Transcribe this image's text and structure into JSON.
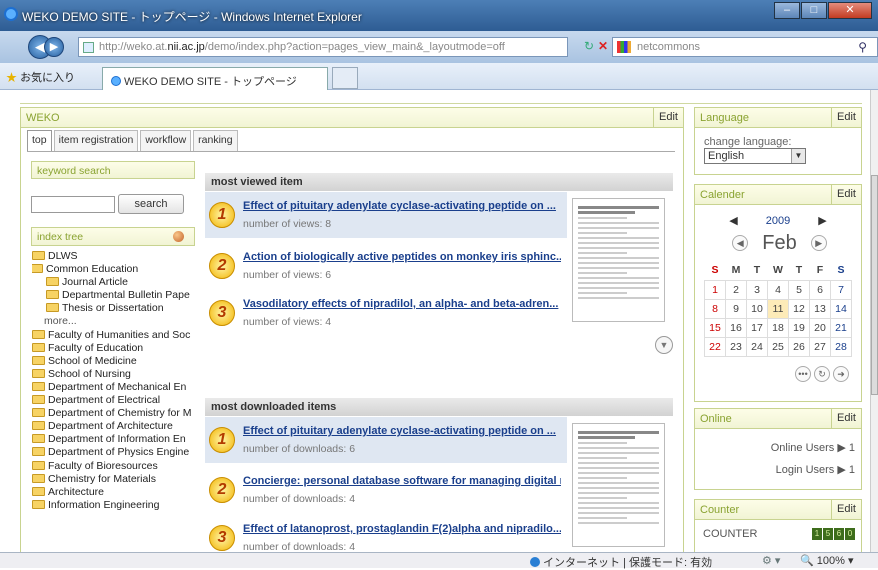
{
  "window": {
    "title": "WEKO DEMO SITE - トップページ - Windows Internet Explorer"
  },
  "browser": {
    "url_host_prefix": "http://weko.at.",
    "url_host_bold": "nii.ac.jp",
    "url_path": "/demo/index.php?action=pages_view_main&_layoutmode=off",
    "search_value": "netcommons",
    "favorites_label": "お気に入り",
    "tab_title": "WEKO DEMO SITE - トップページ"
  },
  "weko": {
    "title": "WEKO",
    "edit": "Edit",
    "tabs": [
      "top",
      "item registration",
      "workflow",
      "ranking"
    ],
    "keyword_search_label": "keyword search",
    "search_button": "search",
    "index_tree_label": "index tree",
    "tree": [
      {
        "label": "DLWS",
        "level": 0
      },
      {
        "label": "Common Education",
        "level": 0,
        "expanded": true
      },
      {
        "label": "Journal Article",
        "level": 1
      },
      {
        "label": "Departmental Bulletin Pape",
        "level": 1
      },
      {
        "label": "Thesis or Dissertation",
        "level": 1
      },
      {
        "label": "more...",
        "level": 1,
        "more": true
      },
      {
        "label": "Faculty of Humanities and Soc",
        "level": 0
      },
      {
        "label": "Faculty of Education",
        "level": 0
      },
      {
        "label": "School of Medicine",
        "level": 0
      },
      {
        "label": "School of Nursing",
        "level": 0
      },
      {
        "label": "Department of Mechanical En",
        "level": 0
      },
      {
        "label": "Department of Electrical",
        "level": 0
      },
      {
        "label": "Department of Chemistry for M",
        "level": 0
      },
      {
        "label": "Department of Architecture",
        "level": 0
      },
      {
        "label": "Department of Information En",
        "level": 0
      },
      {
        "label": "Department of Physics Engine",
        "level": 0
      },
      {
        "label": "Faculty of Bioresources",
        "level": 0
      },
      {
        "label": "Chemistry for Materials",
        "level": 0
      },
      {
        "label": "Architecture",
        "level": 0
      },
      {
        "label": "Information Engineering",
        "level": 0
      }
    ],
    "most_viewed": {
      "heading": "most viewed item",
      "items": [
        {
          "rank": "1",
          "title": "Effect of pituitary adenylate cyclase-activating peptide on ...",
          "sub": "number of views: 8"
        },
        {
          "rank": "2",
          "title": "Action of biologically active peptides on monkey iris sphinc...",
          "sub": "number of views: 6"
        },
        {
          "rank": "3",
          "title": "Vasodilatory effects of nipradilol, an alpha- and beta-adren...",
          "sub": "number of views: 4"
        }
      ]
    },
    "most_downloaded": {
      "heading": "most downloaded items",
      "items": [
        {
          "rank": "1",
          "title": "Effect of pituitary adenylate cyclase-activating peptide on ...",
          "sub": "number of downloads: 6"
        },
        {
          "rank": "2",
          "title": "Concierge: personal database software for managing digital r...",
          "sub": "number of downloads: 4"
        },
        {
          "rank": "3",
          "title": "Effect of latanoprost, prostaglandin F(2)alpha and nipradilo...",
          "sub": "number of downloads: 4"
        }
      ]
    }
  },
  "language": {
    "title": "Language",
    "edit": "Edit",
    "label": "change language:",
    "selected": "English"
  },
  "calendar": {
    "title": "Calender",
    "edit": "Edit",
    "year": "2009",
    "month": "Feb",
    "weekdays": [
      "S",
      "M",
      "T",
      "W",
      "T",
      "F",
      "S"
    ],
    "weeks": [
      [
        "1",
        "2",
        "3",
        "4",
        "5",
        "6",
        "7"
      ],
      [
        "8",
        "9",
        "10",
        "11",
        "12",
        "13",
        "14"
      ],
      [
        "15",
        "16",
        "17",
        "18",
        "19",
        "20",
        "21"
      ],
      [
        "22",
        "23",
        "24",
        "25",
        "26",
        "27",
        "28"
      ]
    ],
    "today": "11"
  },
  "online": {
    "title": "Online",
    "edit": "Edit",
    "users": "Online Users ▶ 1",
    "login": "Login Users ▶ 1"
  },
  "counter": {
    "title": "Counter",
    "edit": "Edit",
    "label": "COUNTER",
    "digits": [
      "1",
      "5",
      "6",
      "0"
    ]
  },
  "status": {
    "zone": "インターネット | 保護モード: 有効",
    "zoom": "100%"
  }
}
